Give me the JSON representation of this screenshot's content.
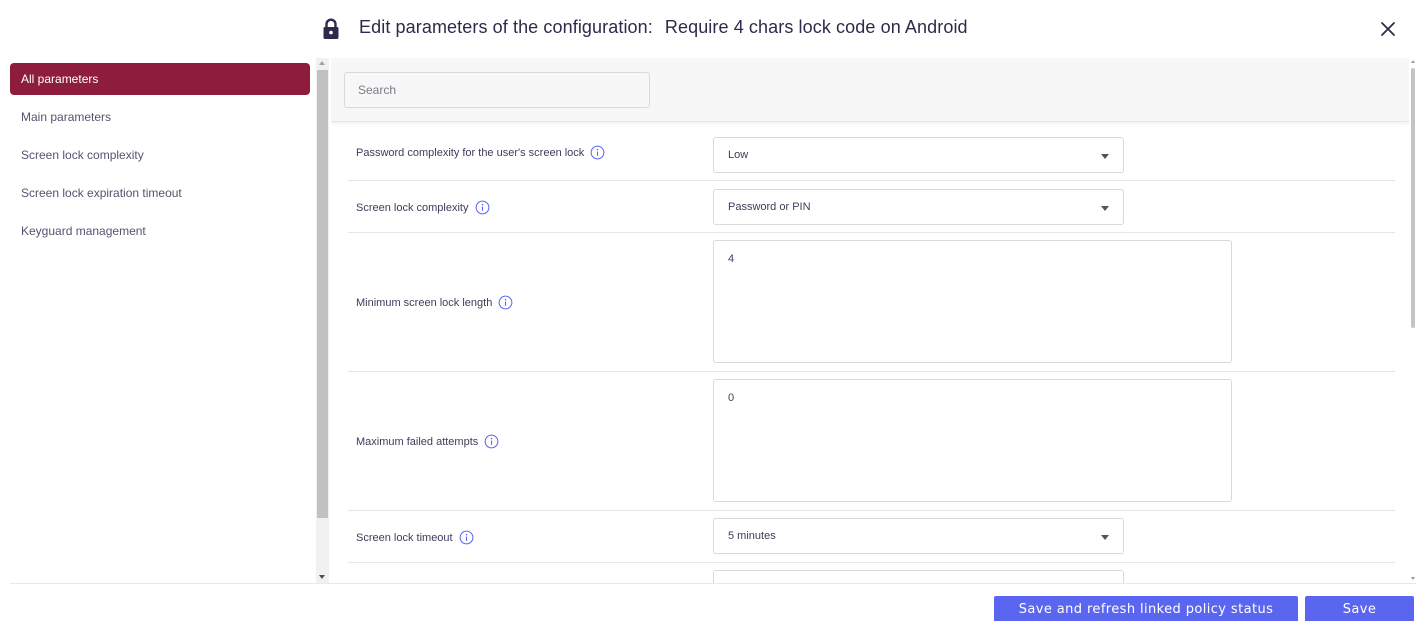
{
  "header": {
    "title_prefix": "Edit parameters of the configuration:",
    "config_name": "Require 4 chars lock code on Android",
    "lock_icon": "lock-icon",
    "close_icon": "close-icon"
  },
  "sidebar": {
    "items": [
      {
        "label": "All parameters",
        "active": true
      },
      {
        "label": "Main parameters",
        "active": false
      },
      {
        "label": "Screen lock complexity",
        "active": false
      },
      {
        "label": "Screen lock expiration timeout",
        "active": false
      },
      {
        "label": "Keyguard management",
        "active": false
      }
    ]
  },
  "search": {
    "placeholder": "Search",
    "value": ""
  },
  "parameters": [
    {
      "label": "Password complexity for the user's screen lock",
      "type": "select",
      "value": "Low"
    },
    {
      "label": "Screen lock complexity",
      "type": "select",
      "value": "Password or PIN"
    },
    {
      "label": "Minimum screen lock length",
      "type": "textarea",
      "value": "4"
    },
    {
      "label": "Maximum failed attempts",
      "type": "textarea",
      "value": "0"
    },
    {
      "label": "Screen lock timeout",
      "type": "select",
      "value": "5 minutes"
    }
  ],
  "footer": {
    "refresh_label": "Save and refresh linked policy status",
    "save_label": "Save"
  },
  "colors": {
    "active_item_bg": "#8d1c3d",
    "primary_button": "#5b66f0",
    "title_text": "#2d2b4b"
  }
}
